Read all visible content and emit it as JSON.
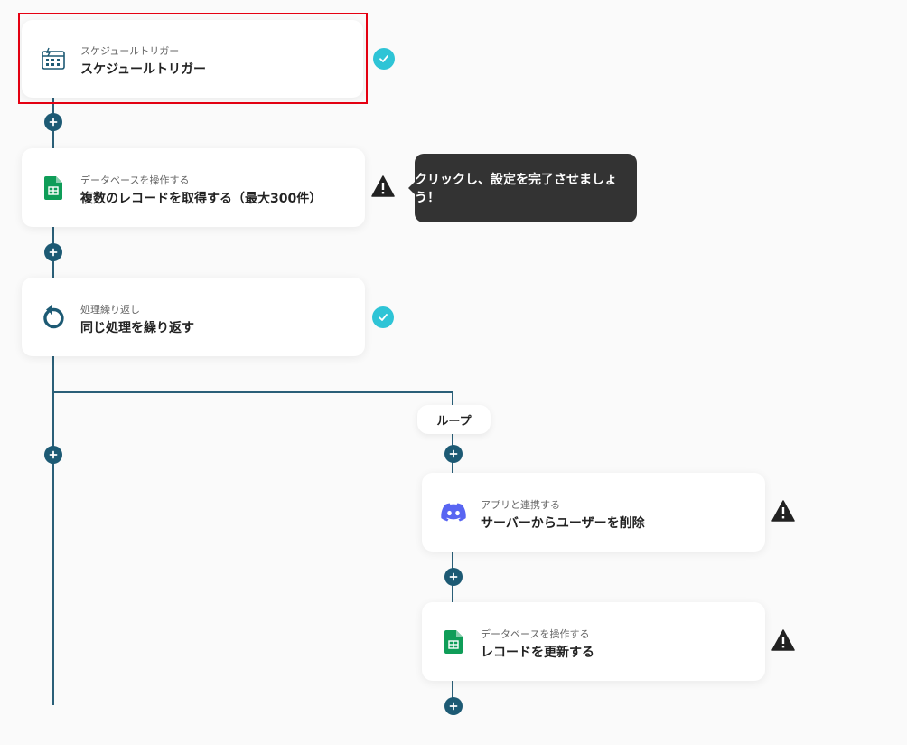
{
  "steps": [
    {
      "sub": "スケジュールトリガー",
      "title": "スケジュールトリガー",
      "icon": "schedule-calendar-icon",
      "status": "complete"
    },
    {
      "sub": "データベースを操作する",
      "title": "複数のレコードを取得する（最大300件）",
      "icon": "google-sheets-icon",
      "status": "warning"
    },
    {
      "sub": "処理繰り返し",
      "title": "同じ処理を繰り返す",
      "icon": "loop-arrow-icon",
      "status": "complete"
    }
  ],
  "loop": {
    "label": "ループ",
    "steps": [
      {
        "sub": "アプリと連携する",
        "title": "サーバーからユーザーを削除",
        "icon": "discord-icon",
        "status": "warning"
      },
      {
        "sub": "データベースを操作する",
        "title": "レコードを更新する",
        "icon": "google-sheets-icon",
        "status": "warning"
      }
    ]
  },
  "tooltip": {
    "text": "クリックし、設定を完了させましょう！"
  },
  "colors": {
    "connector": "#2a5f78",
    "complete": "#2ec4d6",
    "warning": "#222222",
    "selected_border": "#e60012",
    "discord": "#5865f2",
    "sheets": "#0f9d58"
  }
}
